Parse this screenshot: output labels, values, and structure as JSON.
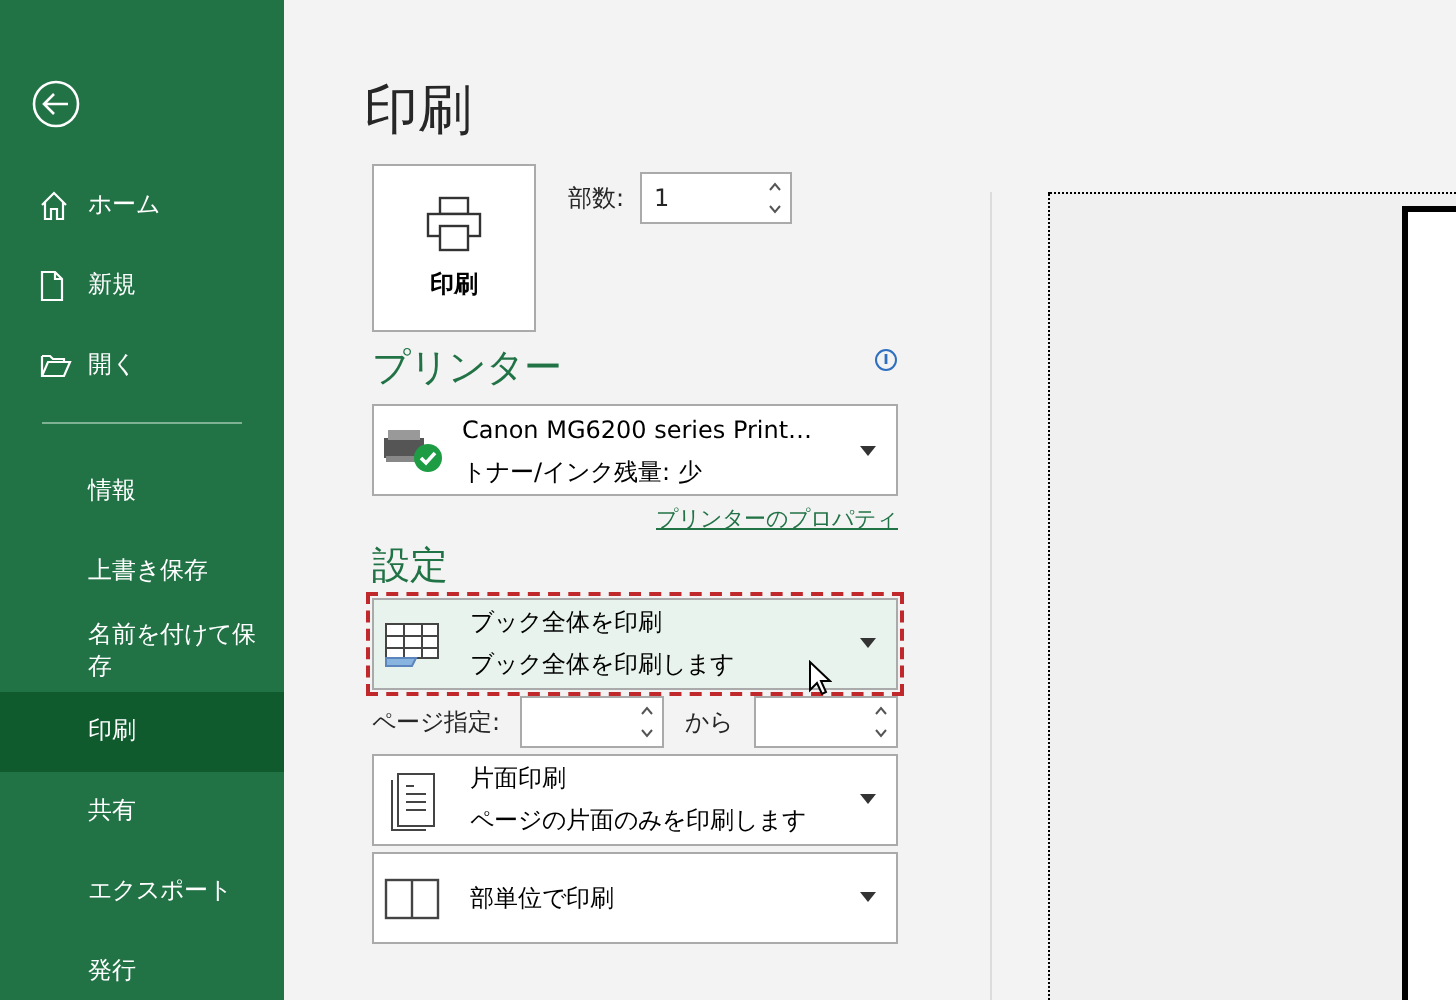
{
  "sidebar": {
    "items": [
      {
        "label": "ホーム",
        "selected": false
      },
      {
        "label": "新規",
        "selected": false
      },
      {
        "label": "開く",
        "selected": false
      },
      {
        "label": "情報",
        "selected": false
      },
      {
        "label": "上書き保存",
        "selected": false
      },
      {
        "label": "名前を付けて保存",
        "selected": false
      },
      {
        "label": "印刷",
        "selected": true
      },
      {
        "label": "共有",
        "selected": false
      },
      {
        "label": "エクスポート",
        "selected": false
      },
      {
        "label": "発行",
        "selected": false
      }
    ]
  },
  "page_title": "印刷",
  "print_button": {
    "label": "印刷"
  },
  "copies": {
    "label": "部数:",
    "value": "1"
  },
  "printer": {
    "heading": "プリンター",
    "name": "Canon MG6200 series Print…",
    "status": "トナー/インク残量: 少",
    "properties_link": "プリンターのプロパティ"
  },
  "settings": {
    "heading": "設定",
    "items": [
      {
        "kind": "print-what",
        "title": "ブック全体を印刷",
        "description": "ブック全体を印刷します",
        "highlighted": true
      },
      {
        "kind": "pages",
        "label": "ページ指定:",
        "to_label": "から"
      },
      {
        "kind": "sides",
        "title": "片面印刷",
        "description": "ページの片面のみを印刷します",
        "highlighted": false
      },
      {
        "kind": "collate",
        "title": "部単位で印刷",
        "highlighted": false
      }
    ]
  }
}
